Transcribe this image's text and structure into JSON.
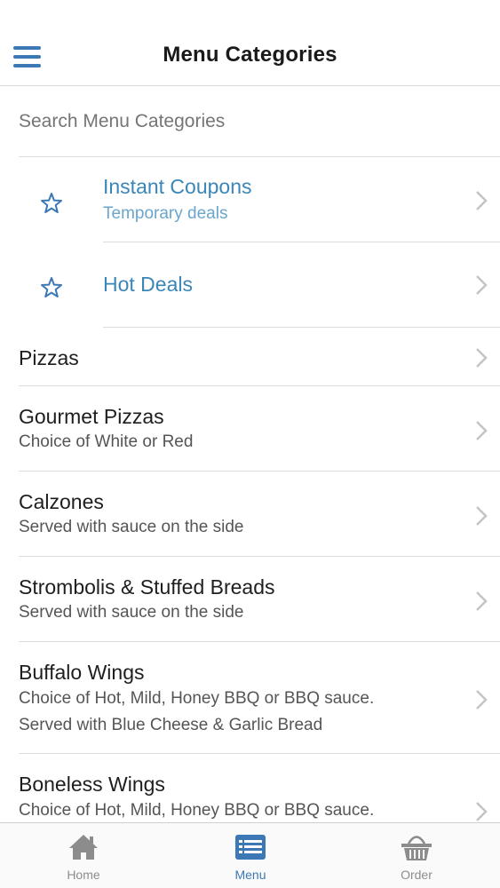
{
  "header": {
    "title": "Menu Categories"
  },
  "search": {
    "placeholder": "Search Menu Categories"
  },
  "featured": [
    {
      "name": "Instant Coupons",
      "desc": "Temporary deals",
      "icon": "star-icon"
    },
    {
      "name": "Hot Deals",
      "desc": "",
      "icon": "star-icon"
    }
  ],
  "categories": [
    {
      "name": "Pizzas",
      "desc": []
    },
    {
      "name": "Gourmet Pizzas",
      "desc": [
        "Choice of White or Red"
      ]
    },
    {
      "name": "Calzones",
      "desc": [
        "Served with sauce on the side"
      ]
    },
    {
      "name": "Strombolis & Stuffed Breads",
      "desc": [
        "Served with sauce on the side"
      ]
    },
    {
      "name": "Buffalo Wings",
      "desc": [
        "Choice of Hot, Mild, Honey BBQ or BBQ sauce.",
        "Served with Blue Cheese & Garlic Bread"
      ]
    },
    {
      "name": "Boneless Wings",
      "desc": [
        "Choice of Hot, Mild, Honey BBQ or BBQ sauce."
      ]
    }
  ],
  "tabbar": {
    "home": {
      "label": "Home",
      "icon": "home-icon"
    },
    "menu": {
      "label": "Menu",
      "icon": "menu-list-icon"
    },
    "order": {
      "label": "Order",
      "icon": "basket-icon"
    }
  },
  "colors": {
    "accent": "#3b78b5",
    "featured_text": "#3a86b8",
    "featured_sub": "#6aa6cc",
    "separator": "#dcdcdc"
  }
}
